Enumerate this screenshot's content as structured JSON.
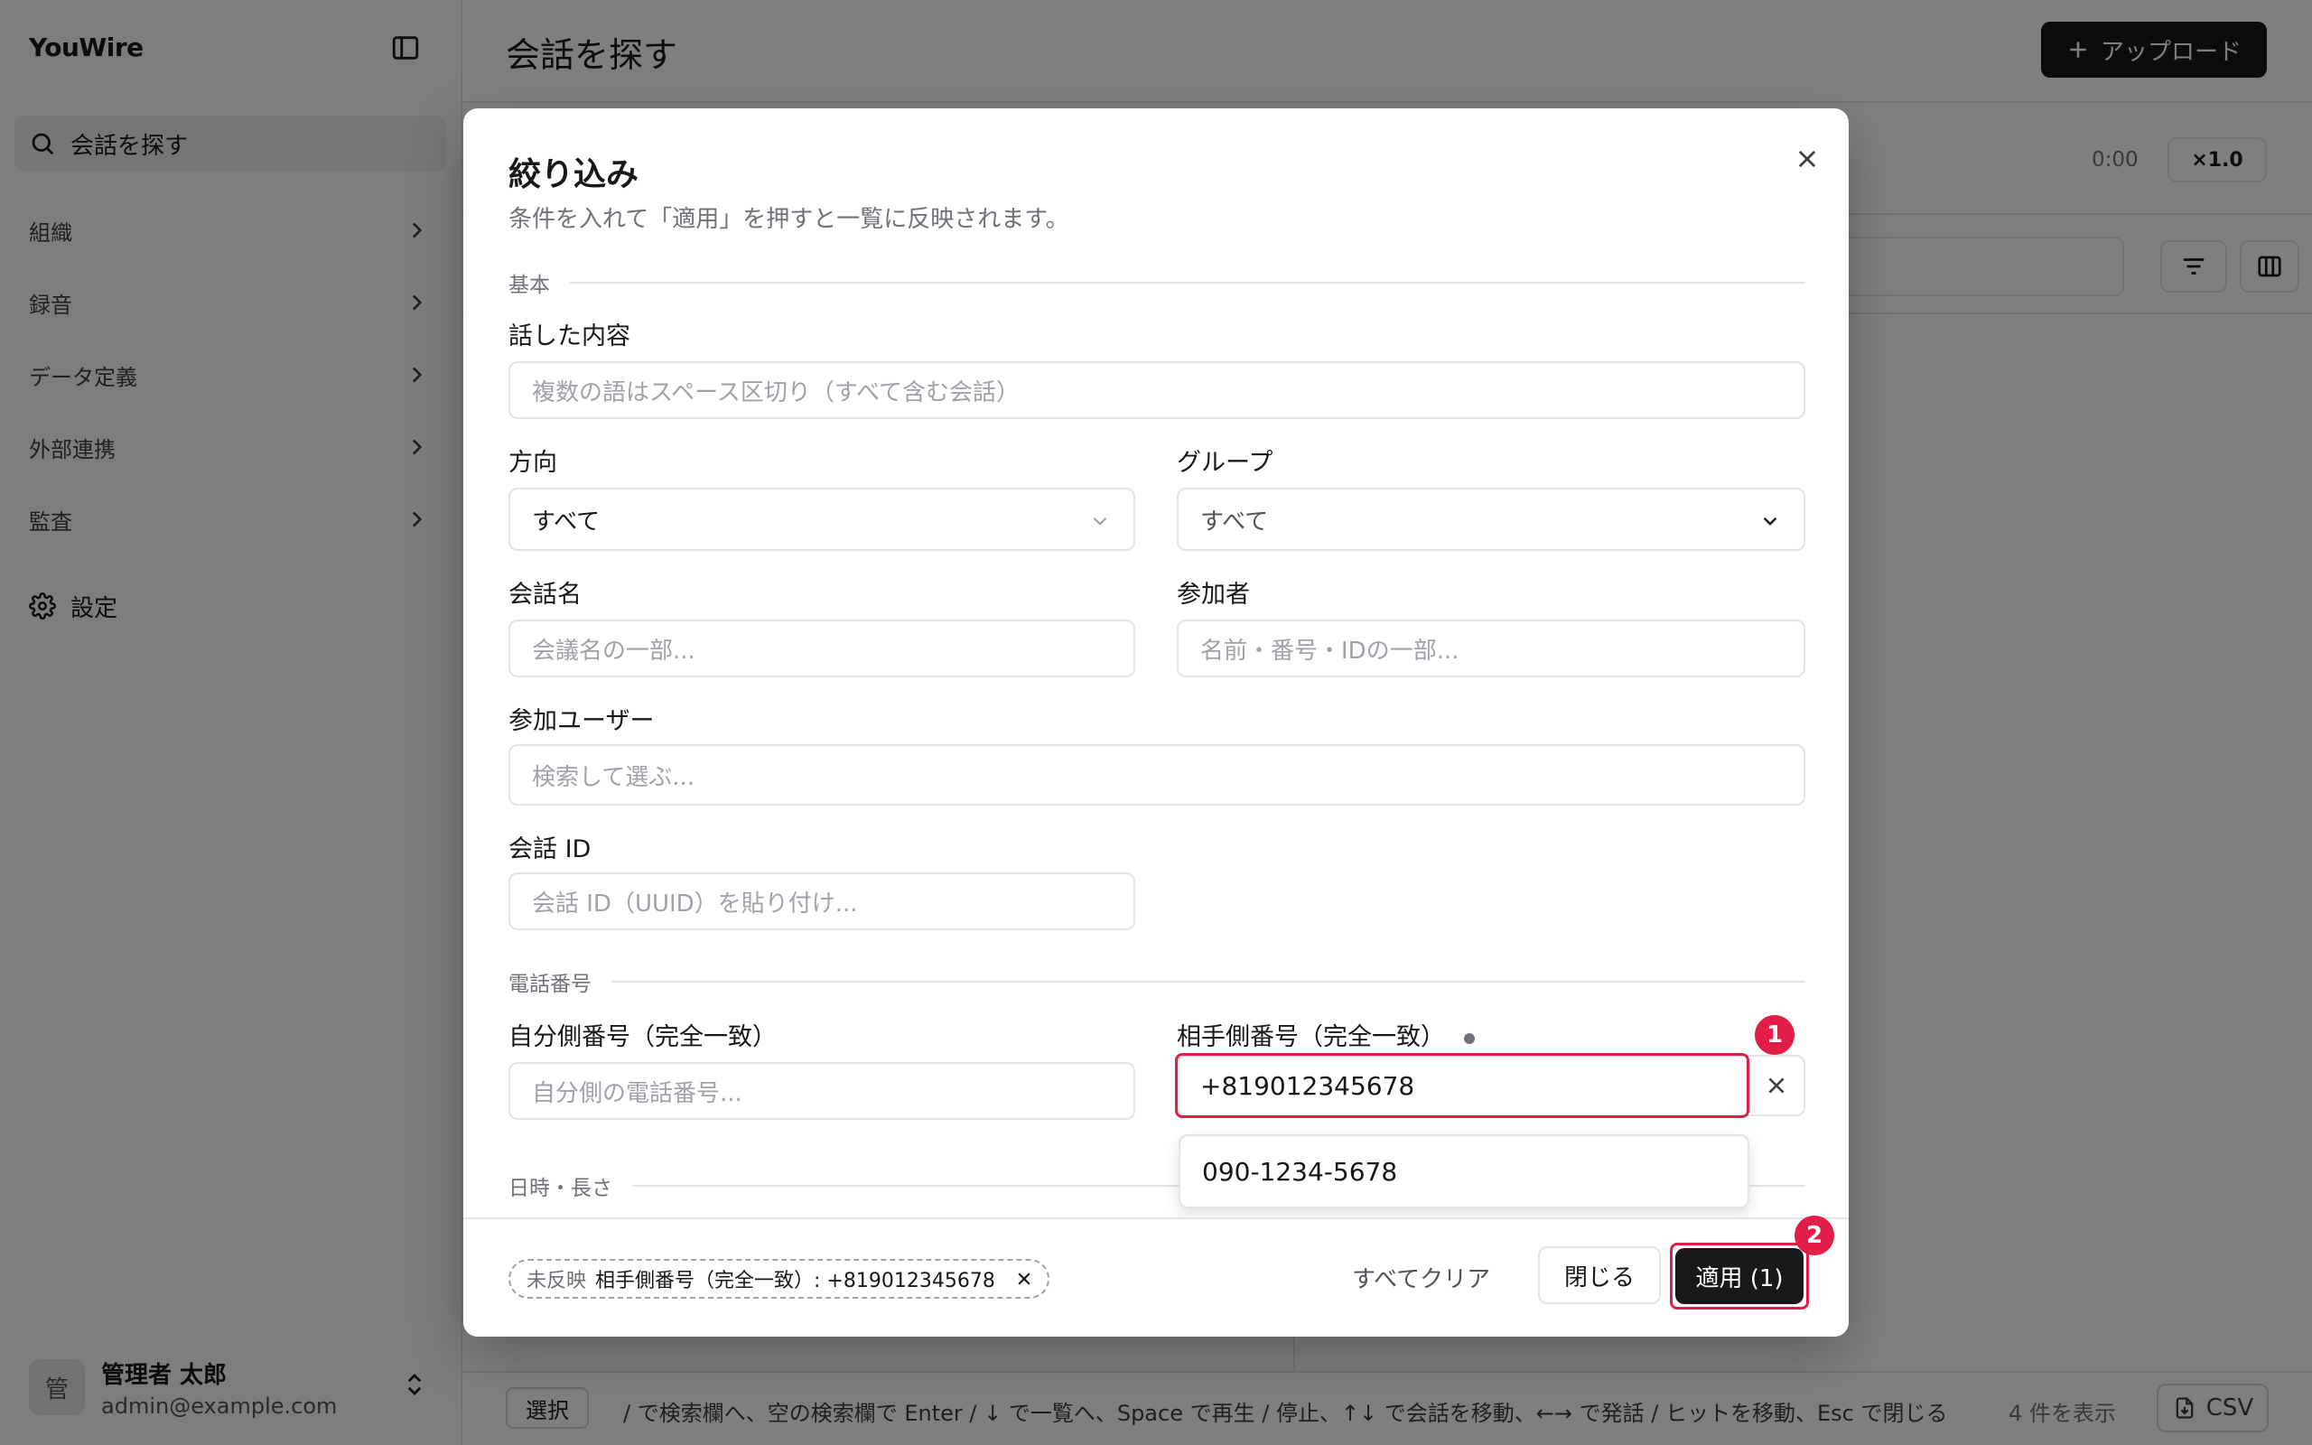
{
  "app": {
    "brand": "YouWire"
  },
  "sidebar": {
    "search_label": "会話を探す",
    "items": [
      {
        "label": "組織"
      },
      {
        "label": "録音"
      },
      {
        "label": "データ定義"
      },
      {
        "label": "外部連携"
      },
      {
        "label": "監査"
      }
    ],
    "settings_label": "設定",
    "user": {
      "avatar": "管",
      "name": "管理者 太郎",
      "email": "admin@example.com"
    }
  },
  "main": {
    "title": "会話を探す",
    "upload_label": "アップロード",
    "player_time": "0:00",
    "speed": "×1.0",
    "footer": {
      "select_key": "選択",
      "hint": "/ で検索欄へ、空の検索欄で Enter / ↓ で一覧へ、Space で再生 / 停止、↑↓ で会話を移動、←→ で発話 / ヒットを移動、Esc で閉じる",
      "count": "4 件を表示",
      "csv_label": "CSV"
    }
  },
  "dialog": {
    "title": "絞り込み",
    "description": "条件を入れて「適用」を押すと一覧に反映されます。",
    "sections": {
      "basic": "基本",
      "phone": "電話番号",
      "datetime": "日時・長さ"
    },
    "content": {
      "label": "話した内容",
      "placeholder": "複数の語はスペース区切り（すべて含む会話）"
    },
    "direction": {
      "label": "方向",
      "value": "すべて"
    },
    "group": {
      "label": "グループ",
      "value": "すべて"
    },
    "conv_name": {
      "label": "会話名",
      "placeholder": "会議名の一部..."
    },
    "participant": {
      "label": "参加者",
      "placeholder": "名前・番号・IDの一部..."
    },
    "participant_user": {
      "label": "参加ユーザー",
      "placeholder": "検索して選ぶ..."
    },
    "conv_id": {
      "label": "会話 ID",
      "placeholder": "会話 ID（UUID）を貼り付け..."
    },
    "own_phone": {
      "label": "自分側番号（完全一致）",
      "placeholder": "自分側の電話番号..."
    },
    "other_phone": {
      "label": "相手側番号（完全一致）",
      "value": "+819012345678"
    },
    "suggestion": "090-1234-5678",
    "annotations": {
      "one": "1",
      "two": "2"
    },
    "footer": {
      "pending_prefix": "未反映",
      "pending_text": "相手側番号（完全一致）: +819012345678",
      "clear_all": "すべてクリア",
      "close": "閉じる",
      "apply": "適用 (1)"
    }
  },
  "colors": {
    "accent": "#18181b",
    "highlight": "#e11d48",
    "overlay": "rgba(0,0,0,0.5)"
  }
}
